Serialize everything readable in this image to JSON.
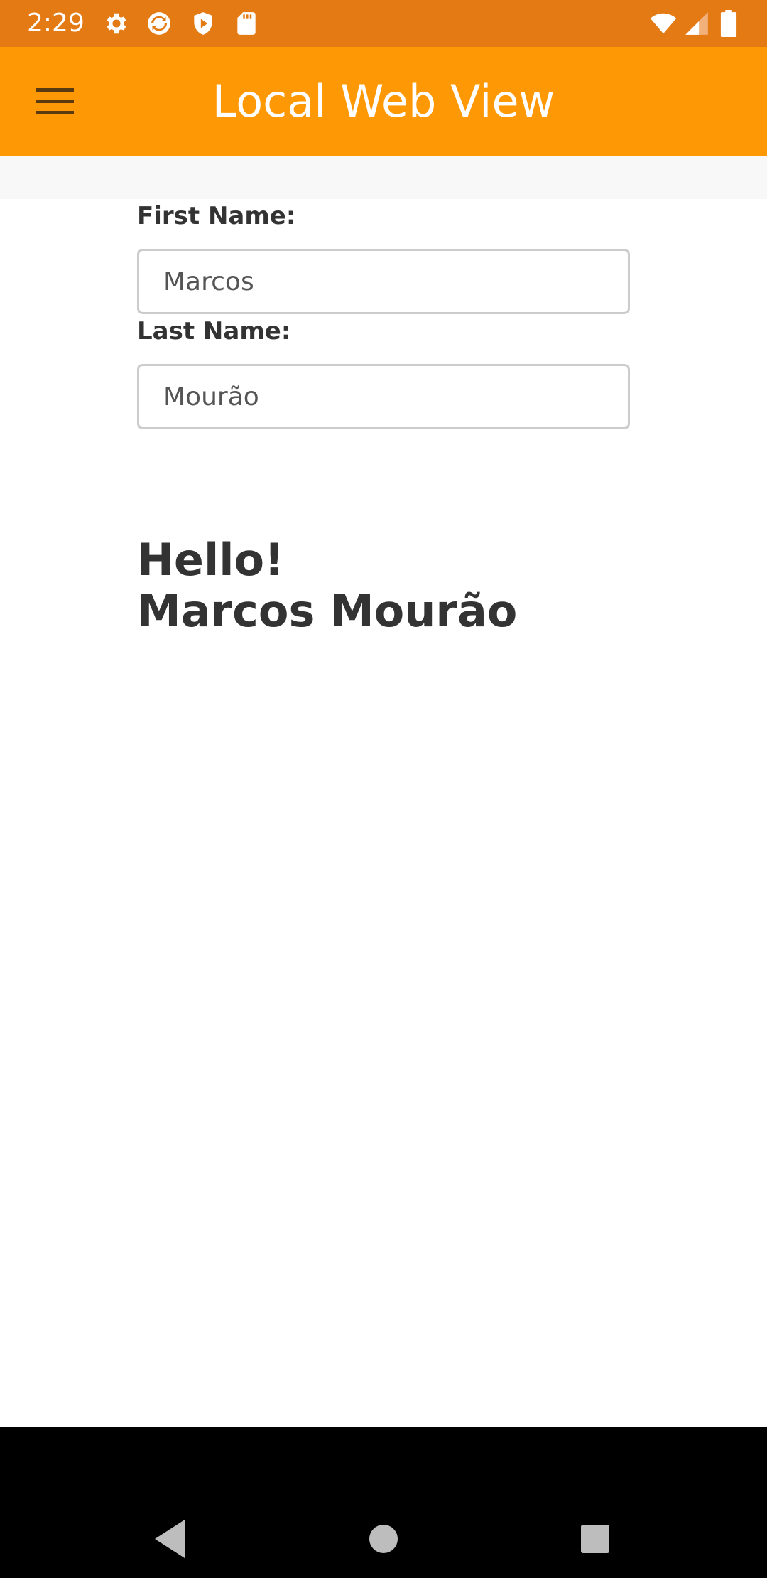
{
  "status_bar": {
    "time": "2:29",
    "icons": [
      "settings-icon",
      "sync-icon",
      "play-protect-icon",
      "sd-card-icon",
      "wifi-icon",
      "signal-icon",
      "battery-icon"
    ]
  },
  "app_bar": {
    "title": "Local Web View",
    "menu_icon": "hamburger-menu-icon",
    "color": "#ff9805"
  },
  "form": {
    "first_name_label": "First Name:",
    "first_name_value": "Marcos",
    "last_name_label": "Last Name:",
    "last_name_value": "Mourão"
  },
  "greeting": {
    "line1": "Hello!",
    "line2": "Marcos Mourão"
  },
  "nav_bar": {
    "icons": [
      "back-icon",
      "home-icon",
      "recents-icon"
    ]
  }
}
